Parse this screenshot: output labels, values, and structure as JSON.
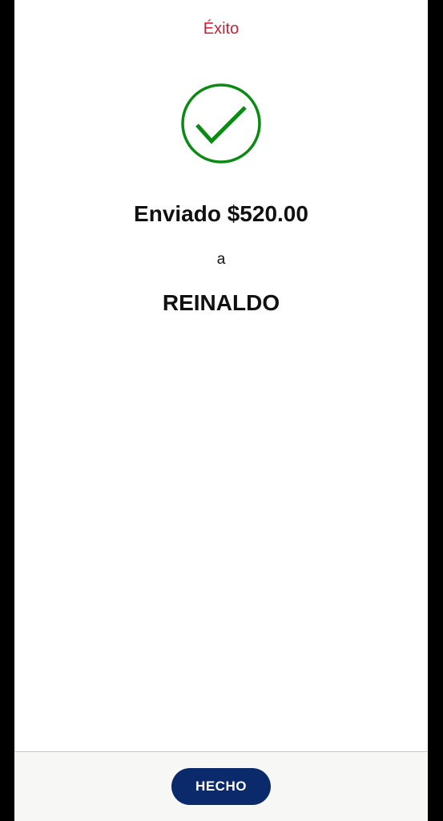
{
  "header": {
    "title": "Éxito",
    "title_color": "#c8213a"
  },
  "status": {
    "icon": "check-circle-icon",
    "icon_color": "#0b8a14"
  },
  "transfer": {
    "amount_text": "Enviado $520.00",
    "connector": "a",
    "recipient": "REINALDO"
  },
  "footer": {
    "done_label": "HECHO",
    "button_color": "#0a2a6b"
  }
}
